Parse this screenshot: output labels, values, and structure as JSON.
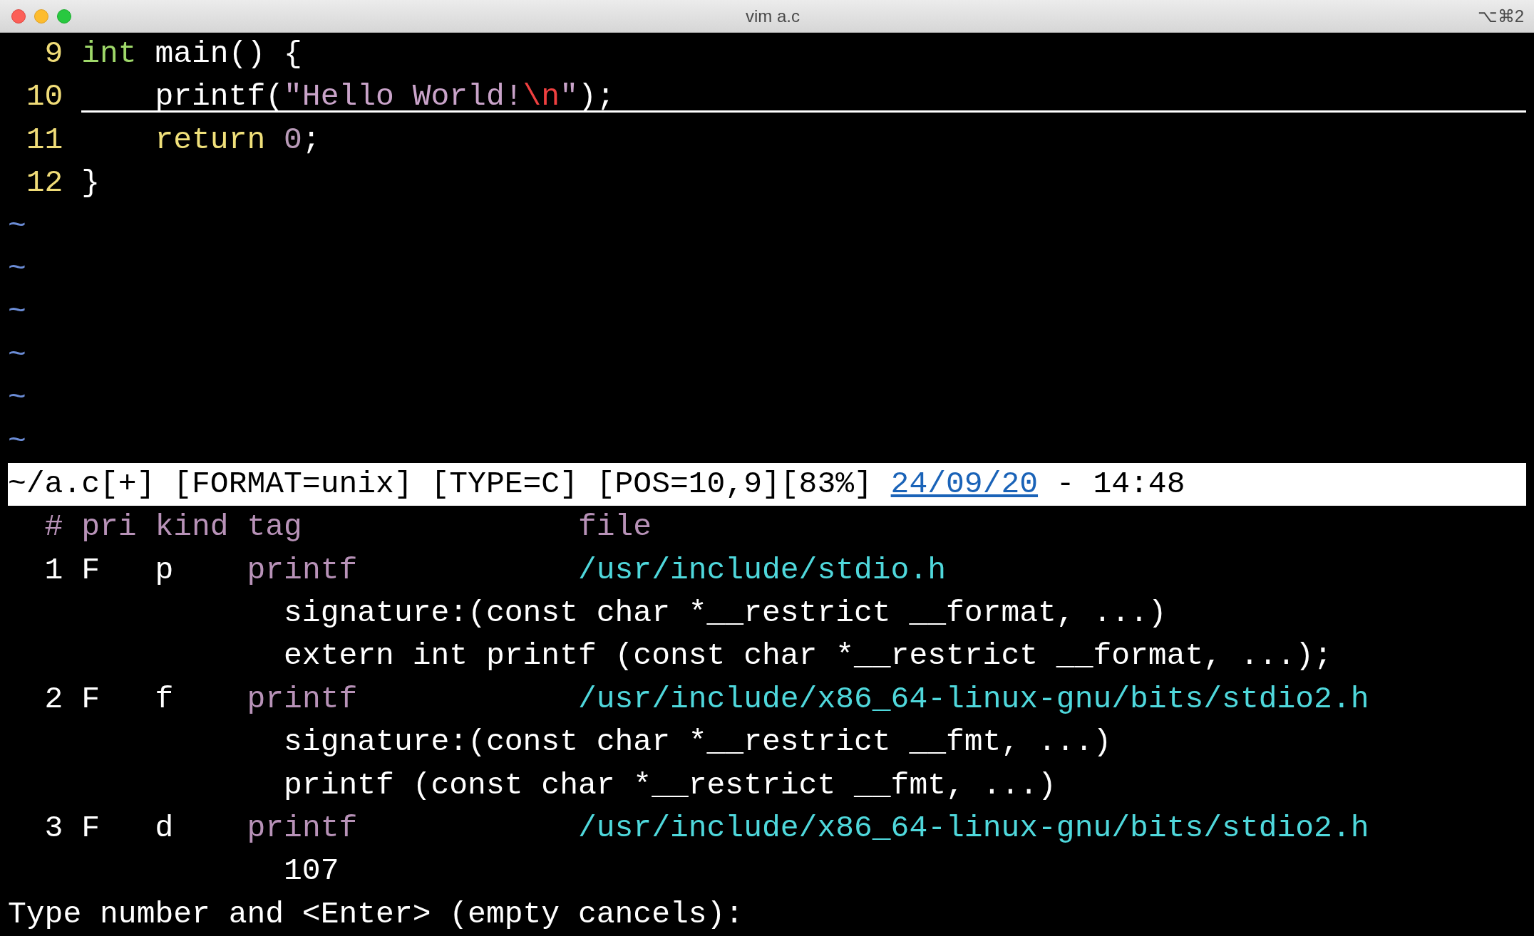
{
  "window": {
    "title": "vim a.c",
    "shortcut": "⌥⌘2"
  },
  "editor": {
    "lines": [
      {
        "number": "9",
        "cursorline": false,
        "segments": [
          {
            "kind": "type",
            "text": "int"
          },
          {
            "kind": "plain",
            "text": " main() {"
          }
        ]
      },
      {
        "number": "10",
        "cursorline": true,
        "segments": [
          {
            "kind": "plain",
            "text": "    printf("
          },
          {
            "kind": "string",
            "text": "\"Hello World!"
          },
          {
            "kind": "special",
            "text": "\\n"
          },
          {
            "kind": "string",
            "text": "\""
          },
          {
            "kind": "plain",
            "text": ");"
          }
        ]
      },
      {
        "number": "11",
        "cursorline": false,
        "segments": [
          {
            "kind": "keyword",
            "text": "    return"
          },
          {
            "kind": "number",
            "text": " 0"
          },
          {
            "kind": "plain",
            "text": ";"
          }
        ]
      },
      {
        "number": "12",
        "cursorline": false,
        "segments": [
          {
            "kind": "plain",
            "text": "}"
          }
        ]
      }
    ],
    "tildes": [
      "~",
      "~",
      "~",
      "~",
      "~",
      "~"
    ]
  },
  "status_line": {
    "segments": [
      {
        "kind": "plain",
        "text": "~/a.c[+] [FORMAT=unix] [TYPE=C] [POS=10,9][83%] "
      },
      {
        "kind": "date",
        "text": "24/09/20"
      },
      {
        "kind": "plain",
        "text": " - 14:48"
      }
    ]
  },
  "tag_list": {
    "rows": [
      {
        "segments": [
          {
            "kind": "header",
            "text": "  # pri kind tag               file"
          }
        ]
      },
      {
        "segments": [
          {
            "kind": "plain",
            "text": "  1 F   p    "
          },
          {
            "kind": "tag",
            "text": "printf"
          },
          {
            "kind": "file",
            "text": "/usr/include/stdio.h"
          }
        ]
      },
      {
        "segments": [
          {
            "kind": "plain",
            "text": "               signature:(const char *__restrict __format, ...)"
          }
        ]
      },
      {
        "segments": [
          {
            "kind": "plain",
            "text": "               extern int printf (const char *__restrict __format, ...);"
          }
        ]
      },
      {
        "segments": [
          {
            "kind": "plain",
            "text": "  2 F   f    "
          },
          {
            "kind": "tag",
            "text": "printf"
          },
          {
            "kind": "file",
            "text": "/usr/include/x86_64-linux-gnu/bits/stdio2.h"
          }
        ]
      },
      {
        "segments": [
          {
            "kind": "plain",
            "text": "               signature:(const char *__restrict __fmt, ...)"
          }
        ]
      },
      {
        "segments": [
          {
            "kind": "plain",
            "text": "               printf (const char *__restrict __fmt, ...)"
          }
        ]
      },
      {
        "segments": [
          {
            "kind": "plain",
            "text": "  3 F   d    "
          },
          {
            "kind": "tag",
            "text": "printf"
          },
          {
            "kind": "file",
            "text": "/usr/include/x86_64-linux-gnu/bits/stdio2.h"
          }
        ]
      },
      {
        "segments": [
          {
            "kind": "plain",
            "text": "               107"
          }
        ]
      }
    ]
  },
  "prompt": "Type number and <Enter> (empty cancels):"
}
